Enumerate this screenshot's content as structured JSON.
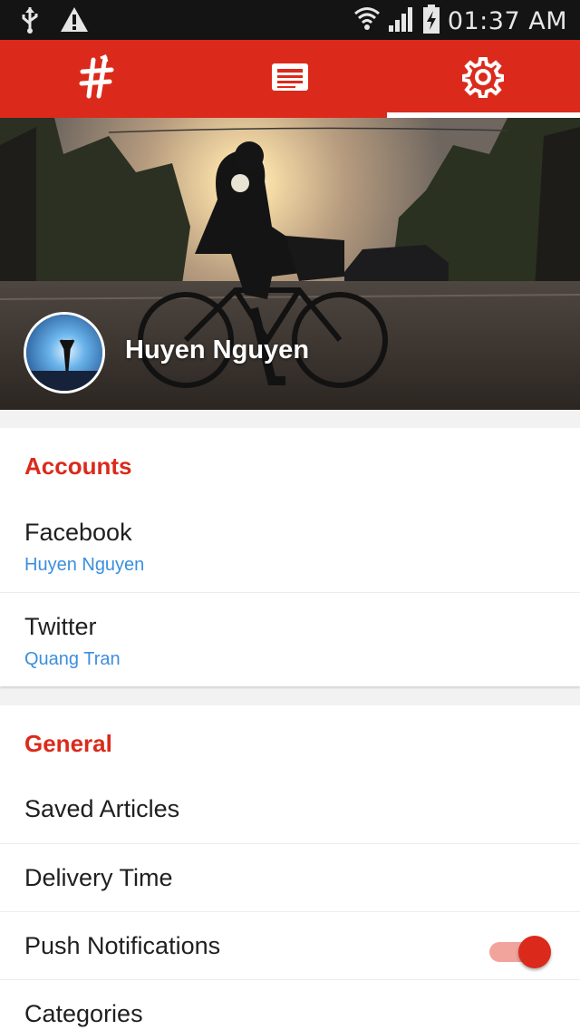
{
  "status_bar": {
    "time": "01:37 AM",
    "icons": [
      "usb-icon",
      "warning-icon",
      "wifi-icon",
      "signal-icon",
      "battery-charging-icon"
    ]
  },
  "tabs": [
    {
      "name": "hashtag",
      "icon": "hashtag-icon",
      "active": false
    },
    {
      "name": "news",
      "icon": "newspaper-icon",
      "active": false
    },
    {
      "name": "settings",
      "icon": "gear-icon",
      "active": true
    }
  ],
  "profile": {
    "name": "Huyen Nguyen"
  },
  "accounts": {
    "title": "Accounts",
    "items": [
      {
        "label": "Facebook",
        "value": "Huyen Nguyen"
      },
      {
        "label": "Twitter",
        "value": "Quang Tran"
      }
    ]
  },
  "general": {
    "title": "General",
    "items": [
      {
        "label": "Saved Articles"
      },
      {
        "label": "Delivery Time"
      },
      {
        "label": "Push Notifications",
        "toggle": true
      },
      {
        "label": "Categories"
      }
    ]
  },
  "colors": {
    "accent": "#db2a1b",
    "link": "#3a8fde",
    "status_bar": "#141414"
  }
}
